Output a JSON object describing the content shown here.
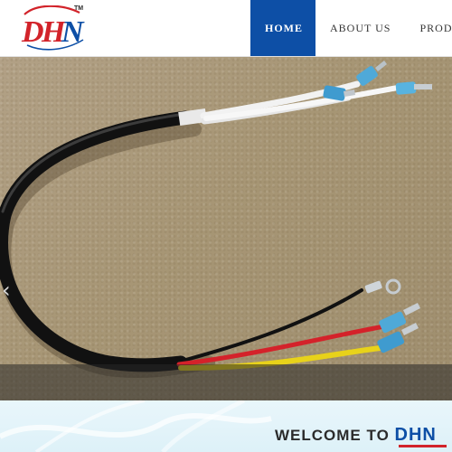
{
  "header": {
    "logo_text": "DHN",
    "logo_tm": "TM",
    "nav": [
      {
        "label": "HOME",
        "active": true
      },
      {
        "label": "ABOUT US",
        "active": false
      },
      {
        "label": "PROD",
        "active": false
      }
    ]
  },
  "hero": {
    "prev_icon": "chevron-left-icon"
  },
  "welcome": {
    "prefix": "WELCOME TO",
    "brand": "DHN"
  },
  "colors": {
    "brand_blue": "#0d4fa6",
    "brand_red": "#d2232a",
    "hero_background": "#a89777",
    "welcome_band": "#e4f4fa"
  }
}
